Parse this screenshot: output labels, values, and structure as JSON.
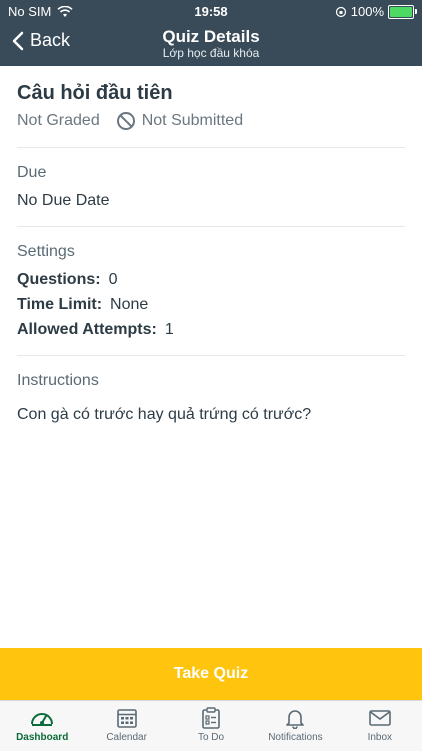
{
  "status_bar": {
    "carrier": "No SIM",
    "time": "19:58",
    "battery": "100%",
    "wifi_icon": "wifi-icon",
    "lock_icon": "orientation-lock-icon"
  },
  "nav": {
    "back_label": "Back",
    "title": "Quiz Details",
    "subtitle": "Lớp học đầu khóa"
  },
  "quiz": {
    "title": "Câu hỏi đầu tiên",
    "grade_status": "Not Graded",
    "submission_status": "Not Submitted"
  },
  "due": {
    "label": "Due",
    "value": "No Due Date"
  },
  "settings": {
    "label": "Settings",
    "questions_label": "Questions:",
    "questions_value": "0",
    "time_limit_label": "Time Limit:",
    "time_limit_value": "None",
    "attempts_label": "Allowed Attempts:",
    "attempts_value": "1"
  },
  "instructions": {
    "label": "Instructions",
    "text": "Con gà có trước hay quả trứng có trước?"
  },
  "take_quiz_label": "Take Quiz",
  "tabs": [
    {
      "label": "Dashboard",
      "icon": "dashboard-icon",
      "active": true
    },
    {
      "label": "Calendar",
      "icon": "calendar-icon",
      "active": false
    },
    {
      "label": "To Do",
      "icon": "todo-icon",
      "active": false
    },
    {
      "label": "Notifications",
      "icon": "bell-icon",
      "active": false
    },
    {
      "label": "Inbox",
      "icon": "inbox-icon",
      "active": false
    }
  ],
  "colors": {
    "header_bg": "#394b58",
    "button_bg": "#ffc40d",
    "active_tab": "#0b6b3a"
  }
}
